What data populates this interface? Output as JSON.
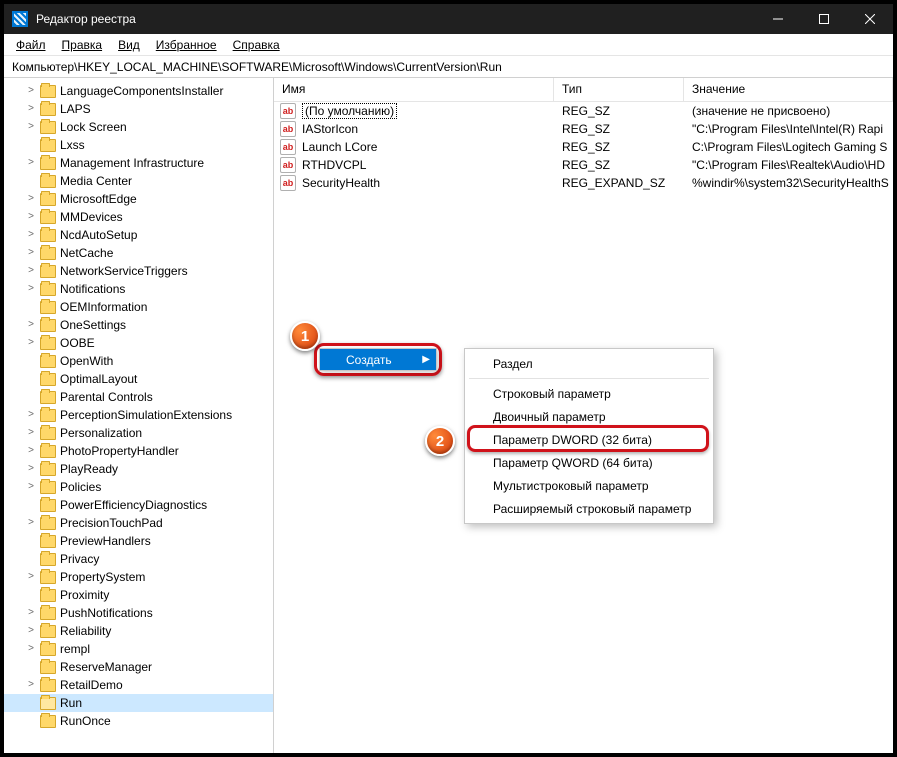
{
  "titlebar": {
    "title": "Редактор реестра"
  },
  "menubar": {
    "file": "Файл",
    "edit": "Правка",
    "view": "Вид",
    "fav": "Избранное",
    "help": "Справка"
  },
  "addressbar": "Компьютер\\HKEY_LOCAL_MACHINE\\SOFTWARE\\Microsoft\\Windows\\CurrentVersion\\Run",
  "tree": [
    {
      "label": "LanguageComponentsInstaller",
      "exp": true
    },
    {
      "label": "LAPS",
      "exp": true
    },
    {
      "label": "Lock Screen",
      "exp": true
    },
    {
      "label": "Lxss",
      "exp": false
    },
    {
      "label": "Management Infrastructure",
      "exp": true
    },
    {
      "label": "Media Center",
      "exp": false
    },
    {
      "label": "MicrosoftEdge",
      "exp": true
    },
    {
      "label": "MMDevices",
      "exp": true
    },
    {
      "label": "NcdAutoSetup",
      "exp": true
    },
    {
      "label": "NetCache",
      "exp": true
    },
    {
      "label": "NetworkServiceTriggers",
      "exp": true
    },
    {
      "label": "Notifications",
      "exp": true
    },
    {
      "label": "OEMInformation",
      "exp": false
    },
    {
      "label": "OneSettings",
      "exp": true
    },
    {
      "label": "OOBE",
      "exp": true
    },
    {
      "label": "OpenWith",
      "exp": false
    },
    {
      "label": "OptimalLayout",
      "exp": false
    },
    {
      "label": "Parental Controls",
      "exp": false
    },
    {
      "label": "PerceptionSimulationExtensions",
      "exp": true
    },
    {
      "label": "Personalization",
      "exp": true
    },
    {
      "label": "PhotoPropertyHandler",
      "exp": true
    },
    {
      "label": "PlayReady",
      "exp": true
    },
    {
      "label": "Policies",
      "exp": true
    },
    {
      "label": "PowerEfficiencyDiagnostics",
      "exp": false
    },
    {
      "label": "PrecisionTouchPad",
      "exp": true
    },
    {
      "label": "PreviewHandlers",
      "exp": false
    },
    {
      "label": "Privacy",
      "exp": false
    },
    {
      "label": "PropertySystem",
      "exp": true
    },
    {
      "label": "Proximity",
      "exp": false
    },
    {
      "label": "PushNotifications",
      "exp": true
    },
    {
      "label": "Reliability",
      "exp": true
    },
    {
      "label": "rempl",
      "exp": true
    },
    {
      "label": "ReserveManager",
      "exp": false
    },
    {
      "label": "RetailDemo",
      "exp": true
    },
    {
      "label": "Run",
      "exp": false,
      "sel": true,
      "open": true
    },
    {
      "label": "RunOnce",
      "exp": false
    }
  ],
  "columns": {
    "name": "Имя",
    "type": "Тип",
    "value": "Значение"
  },
  "rows": [
    {
      "name": "(По умолчанию)",
      "type": "REG_SZ",
      "value": "(значение не присвоено)",
      "default": true
    },
    {
      "name": "IAStorIcon",
      "type": "REG_SZ",
      "value": "\"C:\\Program Files\\Intel\\Intel(R) Rapi"
    },
    {
      "name": "Launch LCore",
      "type": "REG_SZ",
      "value": "C:\\Program Files\\Logitech Gaming S"
    },
    {
      "name": "RTHDVCPL",
      "type": "REG_SZ",
      "value": "\"C:\\Program Files\\Realtek\\Audio\\HD"
    },
    {
      "name": "SecurityHealth",
      "type": "REG_EXPAND_SZ",
      "value": "%windir%\\system32\\SecurityHealthS"
    }
  ],
  "contextmenu": {
    "create": "Создать"
  },
  "submenu": {
    "section": "Раздел",
    "string": "Строковый параметр",
    "binary": "Двоичный параметр",
    "dword": "Параметр DWORD (32 бита)",
    "qword": "Параметр QWORD (64 бита)",
    "multistring": "Мультистроковый параметр",
    "expandstring": "Расширяемый строковый параметр"
  },
  "badges": {
    "one": "1",
    "two": "2"
  }
}
